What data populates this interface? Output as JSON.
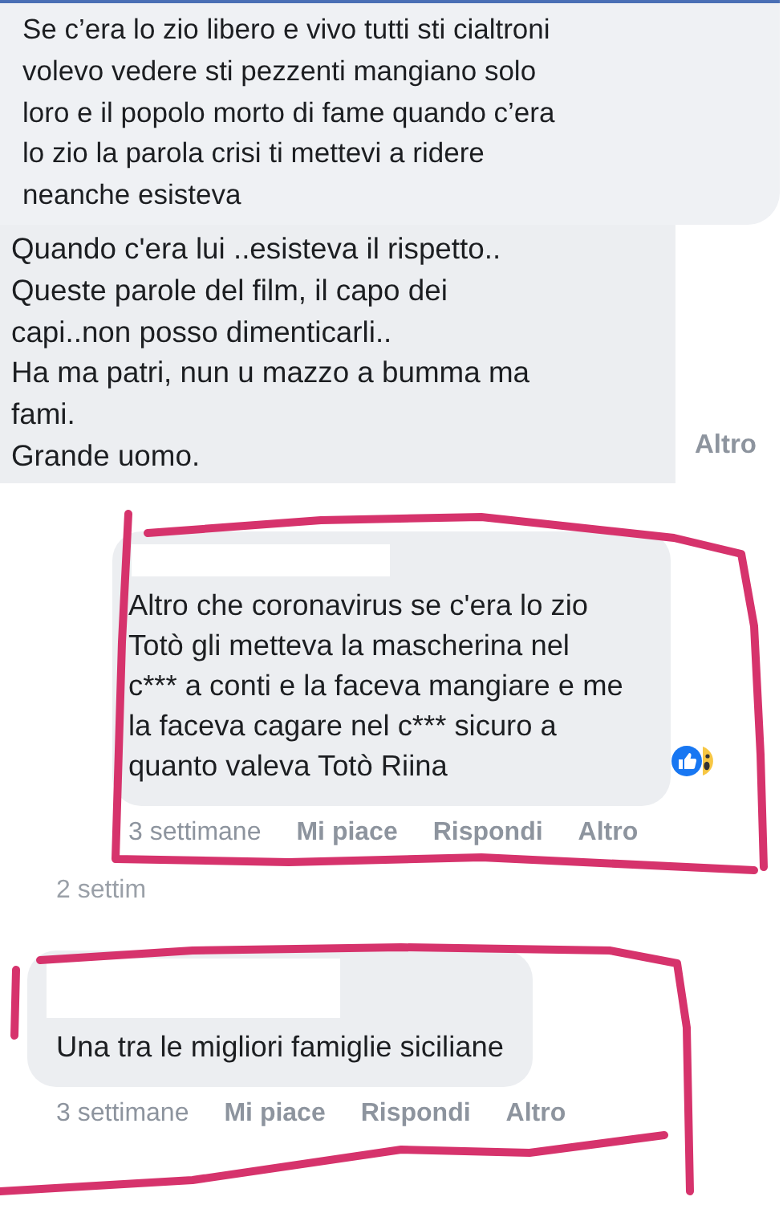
{
  "comments": [
    {
      "kind": "top",
      "text": "Se c’era lo zio libero e vivo tutti sti cialtroni\nvolevo vedere sti pezzenti mangiano solo\nloro e il popolo morto di fame quando c’era\nlo zio la parola crisi ti mettevi a ridere\nneanche esisteva"
    },
    {
      "kind": "side",
      "text": "Quando c'era lui ..esisteva il rispetto..\nQueste parole del film, il capo dei\ncapi..non posso dimenticarli..\nHa ma patri, nun u mazzo a bumma ma\nfami.\nGrande uomo.",
      "more": "Altro"
    },
    {
      "kind": "reply",
      "indent": true,
      "name_hidden": true,
      "reactions": true,
      "text": "Altro che coronavirus se c'era lo zio\nTotò gli metteva la mascherina nel\nc*** a conti e la faceva mangiare e me\nla faceva cagare nel c*** sicuro a\nquanto valeva Totò Riina",
      "time": "3 settimane",
      "actions": [
        "Mi piace",
        "Rispondi",
        "Altro"
      ]
    },
    {
      "kind": "meta",
      "time": "2 settim"
    },
    {
      "kind": "reply",
      "indent": false,
      "name_hidden": true,
      "reactions": false,
      "text": "Una tra le migliori famiglie siciliane",
      "time": "3 settimane",
      "actions": [
        "Mi piace",
        "Rispondi",
        "Altro"
      ]
    }
  ]
}
